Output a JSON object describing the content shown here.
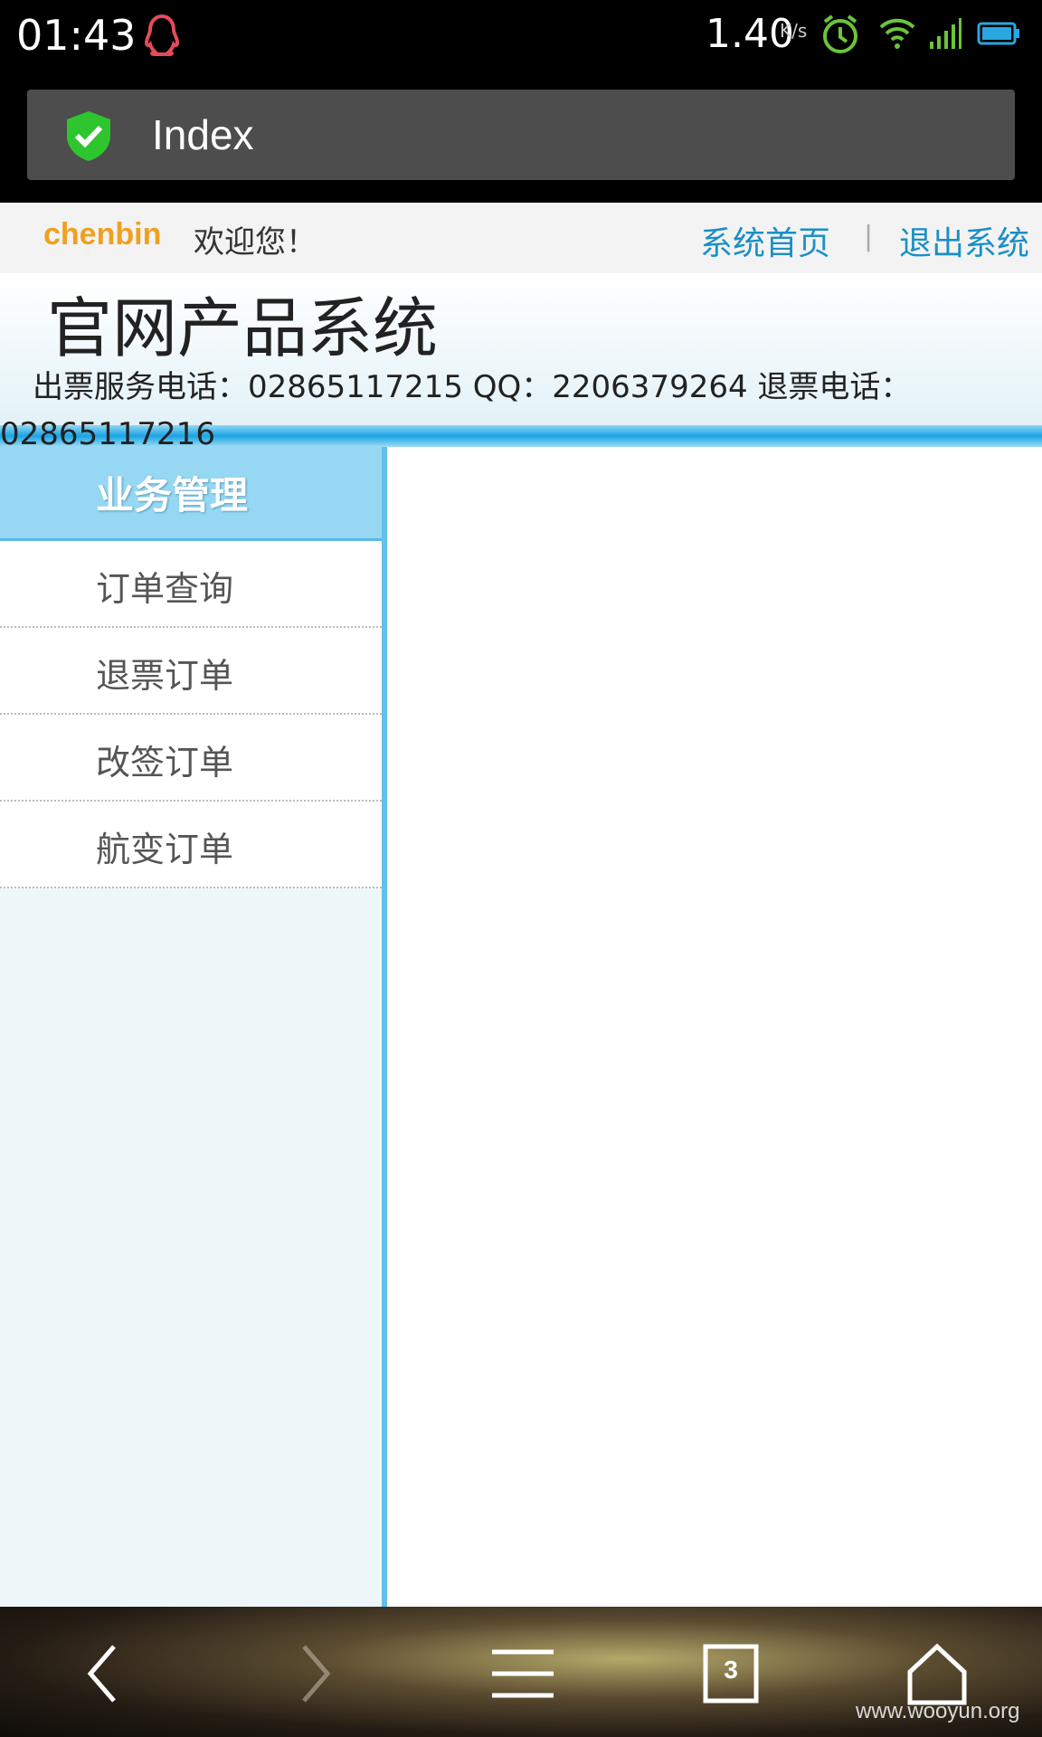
{
  "status_bar": {
    "time": "01:43",
    "net_speed": "1.40",
    "net_speed_unit": "K/s",
    "icons": [
      "qq-icon",
      "alarm-icon",
      "wifi-icon",
      "signal-icon",
      "battery-icon"
    ]
  },
  "browser": {
    "page_title": "Index",
    "security_icon": "shield-check-icon",
    "accent_color": "#2ec52e"
  },
  "user_bar": {
    "username": "chenbin",
    "welcome": "欢迎您！",
    "home_link": "系统首页",
    "separator": "|",
    "logout_link": "退出系统"
  },
  "header": {
    "title": "官网产品系统",
    "phone_line1": "出票服务电话：02865117215 QQ：2206379264 退票电话：",
    "phone_line2": "02865117216"
  },
  "sidebar": {
    "heading": "业务管理",
    "items": [
      {
        "label": "订单查询"
      },
      {
        "label": "退票订单"
      },
      {
        "label": "改签订单"
      },
      {
        "label": "航变订单"
      }
    ]
  },
  "nav_bar": {
    "buttons": [
      "back-icon",
      "forward-icon",
      "menu-icon",
      "tabs-icon",
      "home-icon"
    ],
    "tab_count": "3"
  },
  "watermark": "www.wooyun.org",
  "colors": {
    "link": "#1a8fc7",
    "username": "#f0a020",
    "menu_header": "#96d7f3",
    "rule": "#1aa4e4"
  }
}
